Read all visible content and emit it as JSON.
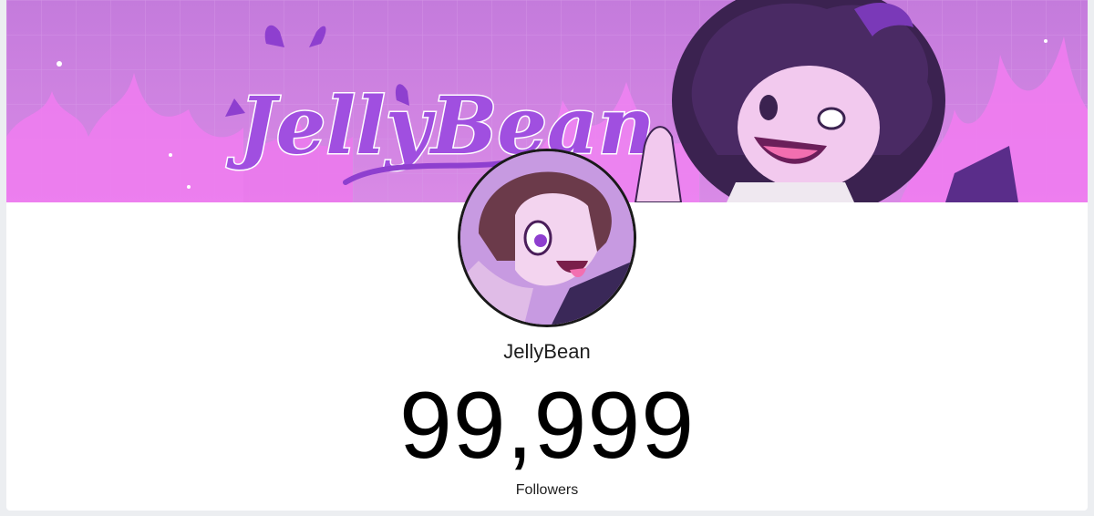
{
  "banner": {
    "logo_text": "JellyBean",
    "accent_color": "#e06bf0",
    "dark_purple": "#3b2250",
    "light_pink": "#f5b6f8"
  },
  "profile": {
    "name": "JellyBean",
    "follower_count": "99,999",
    "follower_label": "Followers"
  }
}
